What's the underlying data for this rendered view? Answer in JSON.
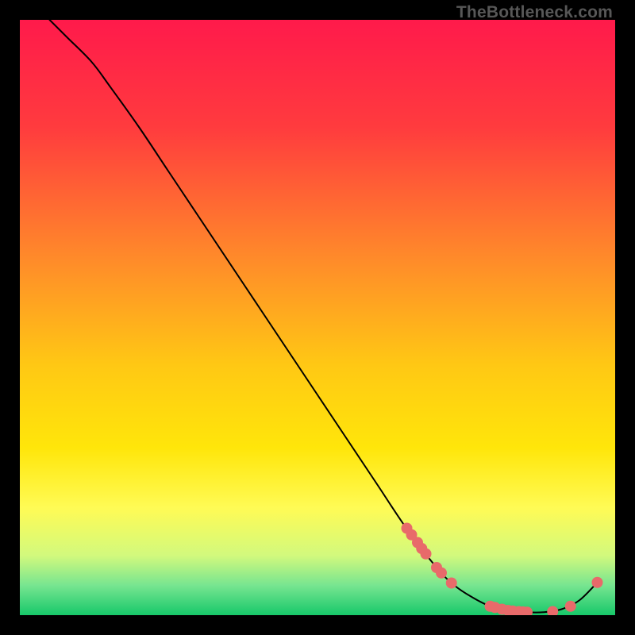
{
  "watermark": "TheBottleneck.com",
  "gradient": {
    "stops": [
      {
        "offset": 0.0,
        "color": "#ff1a4b"
      },
      {
        "offset": 0.18,
        "color": "#ff3b3e"
      },
      {
        "offset": 0.4,
        "color": "#ff8a2a"
      },
      {
        "offset": 0.58,
        "color": "#ffc814"
      },
      {
        "offset": 0.72,
        "color": "#ffe60a"
      },
      {
        "offset": 0.82,
        "color": "#fffb55"
      },
      {
        "offset": 0.9,
        "color": "#d2f97d"
      },
      {
        "offset": 0.95,
        "color": "#77e590"
      },
      {
        "offset": 1.0,
        "color": "#17c86a"
      }
    ]
  },
  "chart_data": {
    "type": "line",
    "x_range": [
      0,
      100
    ],
    "y_range": [
      0,
      100
    ],
    "title": "",
    "xlabel": "",
    "ylabel": "",
    "series": [
      {
        "name": "curve",
        "x": [
          5,
          8,
          12,
          15,
          20,
          25,
          30,
          35,
          40,
          45,
          50,
          55,
          60,
          65,
          70,
          73,
          76,
          79,
          82,
          85,
          88,
          91,
          94,
          97
        ],
        "y": [
          100,
          97,
          93,
          89,
          82,
          74.5,
          67,
          59.5,
          52,
          44.5,
          37,
          29.5,
          22,
          14.5,
          8,
          5,
          3,
          1.5,
          0.8,
          0.5,
          0.5,
          1,
          2.5,
          5.5
        ]
      }
    ],
    "markers": [
      {
        "x": 65.0,
        "y": 14.6
      },
      {
        "x": 65.8,
        "y": 13.5
      },
      {
        "x": 66.8,
        "y": 12.2
      },
      {
        "x": 67.5,
        "y": 11.2
      },
      {
        "x": 68.2,
        "y": 10.3
      },
      {
        "x": 70.0,
        "y": 8.0
      },
      {
        "x": 70.8,
        "y": 7.1
      },
      {
        "x": 72.5,
        "y": 5.4
      },
      {
        "x": 79.0,
        "y": 1.5
      },
      {
        "x": 79.8,
        "y": 1.3
      },
      {
        "x": 81.0,
        "y": 1.0
      },
      {
        "x": 82.0,
        "y": 0.8
      },
      {
        "x": 82.8,
        "y": 0.7
      },
      {
        "x": 83.8,
        "y": 0.6
      },
      {
        "x": 84.5,
        "y": 0.55
      },
      {
        "x": 85.2,
        "y": 0.5
      },
      {
        "x": 89.5,
        "y": 0.6
      },
      {
        "x": 92.5,
        "y": 1.5
      },
      {
        "x": 97.0,
        "y": 5.5
      }
    ],
    "marker_color": "#e86a6a",
    "marker_radius": 7
  }
}
